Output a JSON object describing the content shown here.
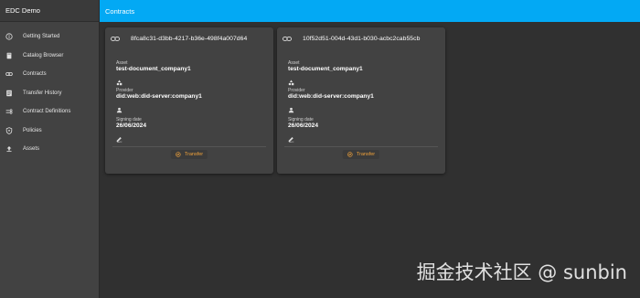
{
  "app": {
    "title": "EDC Demo"
  },
  "topbar": {
    "title": "Contracts"
  },
  "sidebar": {
    "items": [
      {
        "label": "Getting Started",
        "icon": "info-icon"
      },
      {
        "label": "Catalog Browser",
        "icon": "book-icon"
      },
      {
        "label": "Contracts",
        "icon": "link-icon"
      },
      {
        "label": "Transfer History",
        "icon": "list-icon"
      },
      {
        "label": "Contract Definitions",
        "icon": "policy-settings-icon"
      },
      {
        "label": "Policies",
        "icon": "shield-icon"
      },
      {
        "label": "Assets",
        "icon": "upload-icon"
      }
    ]
  },
  "labels": {
    "asset": "Asset",
    "provider": "Provider",
    "signing_date": "Signing date",
    "transfer": "Transfer"
  },
  "contracts": [
    {
      "id": "8fca8c31-d3bb-4217-b36e-498f4a007d64",
      "asset": "test-document_company1",
      "provider": "did:web:did-server:company1",
      "signing_date": "26/06/2024"
    },
    {
      "id": "10f52d51-004d-43d1-b030-acbc2cab55cb",
      "asset": "test-document_company1",
      "provider": "did:web:did-server:company1",
      "signing_date": "26/06/2024"
    }
  ],
  "watermark": "掘金技术社区 @ sunbin",
  "colors": {
    "accent": "#03a9f4",
    "transfer": "#f0a23b",
    "sidebar": "#424242",
    "background": "#303030"
  }
}
